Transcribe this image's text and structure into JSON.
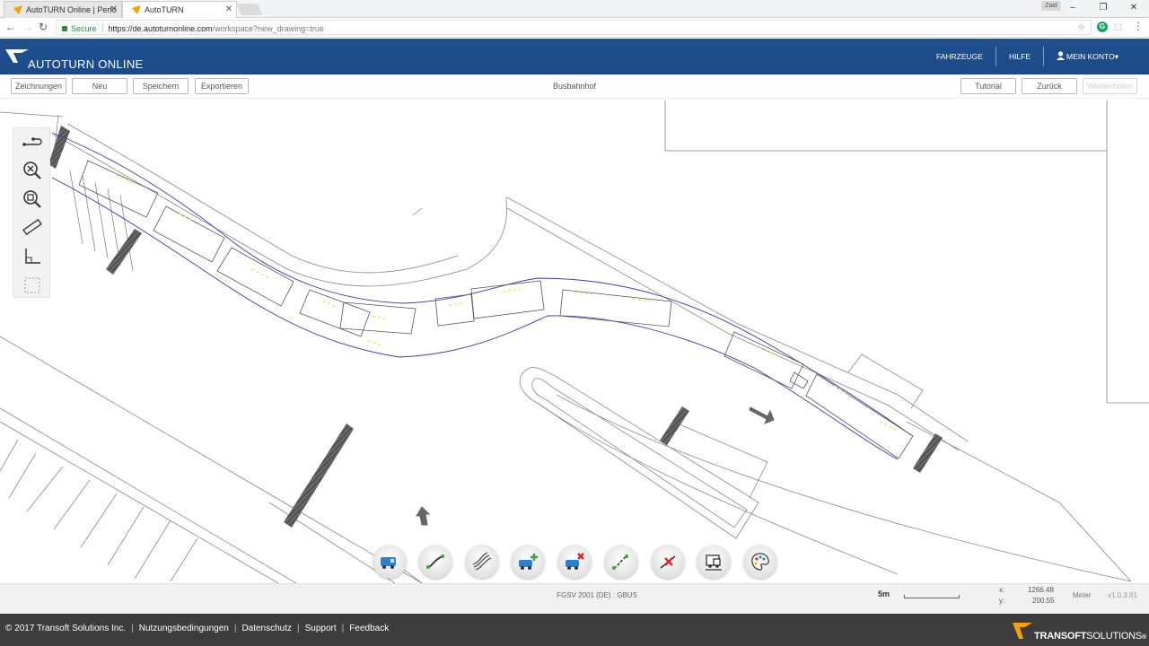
{
  "browser": {
    "tabs": [
      {
        "title": "AutoTURN Online | Perfo",
        "active": false
      },
      {
        "title": "AutoTURN",
        "active": true
      }
    ],
    "user_badge": "Zaid",
    "address": {
      "secure_label": "Secure",
      "url_host": "https://de.autoturnonline.com",
      "url_path": "/workspace?new_drawing=true"
    }
  },
  "header": {
    "logo_text": "AUTOTURN ONLINE",
    "nav": {
      "vehicles": "FAHRZEUGE",
      "help": "HILFE",
      "account": "MEIN KONTO"
    }
  },
  "toolbar": {
    "drawings": "Zeichnungen",
    "new": "Neu",
    "save": "Speichern",
    "export": "Exportieren",
    "drawing_title": "Busbahnhof",
    "tutorial": "Tutorial",
    "back": "Zurück",
    "redo": "Wiederholen"
  },
  "left_tools": [
    "pan-hand-icon",
    "zoom-extents-icon",
    "zoom-window-icon",
    "measure-ruler-icon",
    "ucs-axes-icon",
    "selection-box-icon"
  ],
  "bottom_tools": [
    "vehicle-select-icon",
    "arc-path-icon",
    "swept-path-icon",
    "add-vehicle-icon",
    "remove-vehicle-icon",
    "edit-path-icon",
    "delete-path-icon",
    "clearance-report-icon",
    "color-palette-icon"
  ],
  "status": {
    "vehicle": "FGSV 2001 (DE) : GBUS",
    "scale_label": "5m",
    "x_label": "x:",
    "x_value": "1266.48",
    "y_label": "y:",
    "y_value": "200.55",
    "units": "Meter",
    "version": "v1.0.3.91"
  },
  "footer": {
    "copyright": "© 2017 Transoft Solutions Inc.",
    "terms": "Nutzungsbedingungen",
    "privacy": "Datenschutz",
    "support": "Support",
    "feedback": "Feedback",
    "brand_bold": "TRANSOFT",
    "brand_light": "SOLUTIONS",
    "brand_tm": "®"
  },
  "colors": {
    "header_blue": "#1f4f8c",
    "footer_dark": "#3c3c3c",
    "path_blue": "#3a3aa8",
    "hatch_dark": "#444444"
  }
}
